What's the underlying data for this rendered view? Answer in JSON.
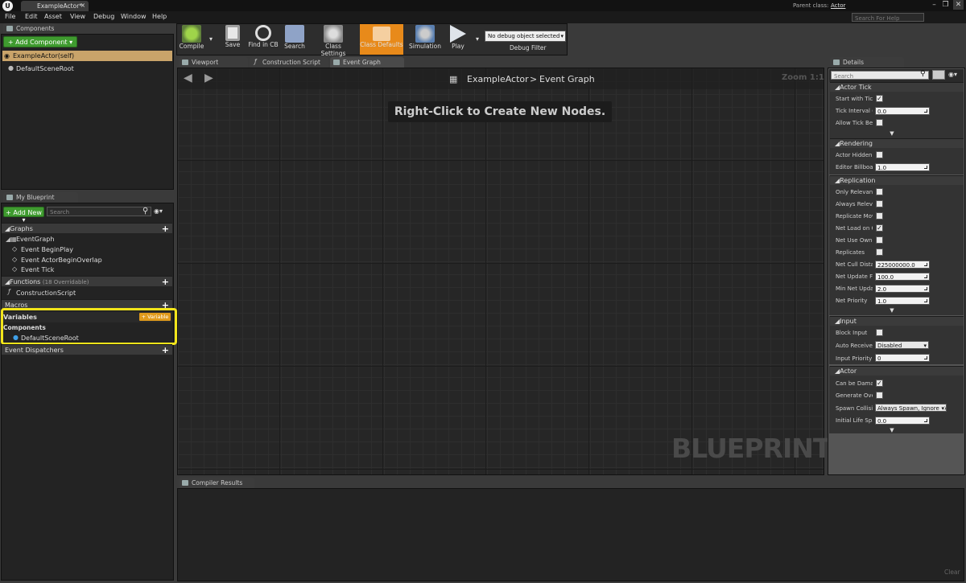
{
  "titlebar": {
    "doc_tab": "ExampleActor*",
    "parent_class_label": "Parent class:",
    "parent_class_value": "Actor",
    "help_placeholder": "Search For Help"
  },
  "menu": [
    "File",
    "Edit",
    "Asset",
    "View",
    "Debug",
    "Window",
    "Help"
  ],
  "toolbar": {
    "compile": "Compile",
    "save": "Save",
    "find": "Find in CB",
    "search": "Search",
    "class_settings": "Class Settings",
    "class_defaults": "Class Defaults",
    "simulation": "Simulation",
    "play": "Play",
    "debug_select": "No debug object selected",
    "debug_filter": "Debug Filter"
  },
  "components": {
    "tab": "Components",
    "add_button": "Add Component",
    "root": "ExampleActor(self)",
    "child": "DefaultSceneRoot"
  },
  "my_blueprint": {
    "tab": "My Blueprint",
    "add_new": "Add New",
    "search_placeholder": "Search",
    "graphs": "Graphs",
    "event_graph": "EventGraph",
    "events": [
      "Event BeginPlay",
      "Event ActorBeginOverlap",
      "Event Tick"
    ],
    "functions": "Functions",
    "functions_count": "(18 Overridable)",
    "construction_script": "ConstructionScript",
    "macros": "Macros",
    "variables": "Variables",
    "variable_button": "Variable",
    "components": "Components",
    "default_scene_root": "DefaultSceneRoot",
    "event_dispatchers": "Event Dispatchers"
  },
  "graph": {
    "tabs": [
      "Viewport",
      "Construction Script",
      "Event Graph"
    ],
    "breadcrumb_actor": "ExampleActor",
    "breadcrumb_sep": ">",
    "breadcrumb_graph": "Event Graph",
    "zoom": "Zoom 1:1",
    "hint": "Right-Click to Create New Nodes.",
    "watermark": "BLUEPRINT"
  },
  "compiler": {
    "tab": "Compiler Results",
    "clear": "Clear"
  },
  "details": {
    "tab": "Details",
    "search_placeholder": "Search",
    "actor_tick": "Actor Tick",
    "start_with_tick": "Start with Tick",
    "tick_interval": "Tick Interval (",
    "tick_interval_val": "0.0",
    "allow_tick": "Allow Tick Bef",
    "rendering": "Rendering",
    "actor_hidden": "Actor Hidden I",
    "editor_billboard": "Editor Billboar",
    "editor_billboard_val": "1.0",
    "replication": "Replication",
    "only_relevant": "Only Relevant",
    "always_relevant": "Always Releva",
    "replicate_movement": "Replicate Mov",
    "net_load": "Net Load on C",
    "net_use_owner": "Net Use Owne",
    "replicates": "Replicates",
    "net_cull": "Net Cull Distar",
    "net_cull_val": "225000000.0",
    "net_update": "Net Update Fr",
    "net_update_val": "100.0",
    "min_net_update": "Min Net Updat",
    "min_net_update_val": "2.0",
    "net_priority": "Net Priority",
    "net_priority_val": "1.0",
    "input": "Input",
    "block_input": "Block Input",
    "auto_receive": "Auto Receive I",
    "auto_receive_val": "Disabled",
    "input_priority": "Input Priority",
    "input_priority_val": "0",
    "actor": "Actor",
    "can_be_damaged": "Can be Damag",
    "generate_overlap": "Generate Over",
    "spawn_collision": "Spawn Collisio",
    "spawn_collision_val": "Always Spawn, Ignore Co",
    "initial_life": "Initial Life Spa",
    "initial_life_val": "0.0"
  },
  "colors": {
    "accent_orange": "#e88a1a",
    "add_green": "#3f9b2f",
    "highlight_yellow": "#f2e51a"
  }
}
